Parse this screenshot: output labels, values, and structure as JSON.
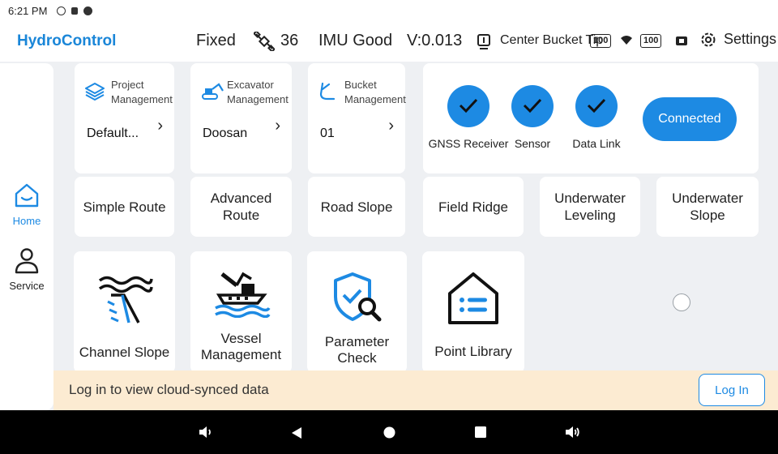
{
  "status_bar": {
    "time": "6:21 PM"
  },
  "header": {
    "app_title": "HydroControl",
    "fix_status": "Fixed",
    "satellite_count": "36",
    "imu_status": "IMU Good",
    "version": "V:0.013",
    "bucket_tip": "Center Bucket Tip",
    "battery_1": "100",
    "battery_2": "100",
    "settings_label": "Settings",
    "accent_color": "#1a86d8"
  },
  "sidebar": {
    "items": [
      {
        "label": "Home",
        "icon": "home-icon",
        "active": true
      },
      {
        "label": "Service",
        "icon": "person-icon",
        "active": false
      }
    ]
  },
  "management": [
    {
      "title_line1": "Project",
      "title_line2": "Management",
      "value": "Default...",
      "icon": "layers-icon"
    },
    {
      "title_line1": "Excavator",
      "title_line2": "Management",
      "value": "Doosan",
      "icon": "excavator-icon"
    },
    {
      "title_line1": "Bucket",
      "title_line2": "Management",
      "value": "01",
      "icon": "bucket-icon"
    }
  ],
  "connection": {
    "checks": [
      "GNSS Receiver",
      "Sensor",
      "Data Link"
    ],
    "button_label": "Connected"
  },
  "routes": [
    {
      "line1": "Simple Route",
      "line2": ""
    },
    {
      "line1": "Advanced Route",
      "line2": ""
    },
    {
      "line1": "Road Slope",
      "line2": ""
    },
    {
      "line1": "Field Ridge",
      "line2": ""
    },
    {
      "line1": "Underwater",
      "line2": "Leveling"
    },
    {
      "line1": "Underwater",
      "line2": "Slope"
    }
  ],
  "tools": [
    {
      "line1": "Channel Slope",
      "line2": "",
      "icon": "channel-slope-icon"
    },
    {
      "line1": "Vessel",
      "line2": "Management",
      "icon": "vessel-icon"
    },
    {
      "line1": "Parameter",
      "line2": "Check",
      "icon": "shield-search-icon"
    },
    {
      "line1": "Point Library",
      "line2": "",
      "icon": "point-library-icon"
    }
  ],
  "banner": {
    "message": "Log in to view cloud-synced data",
    "button_label": "Log In"
  }
}
